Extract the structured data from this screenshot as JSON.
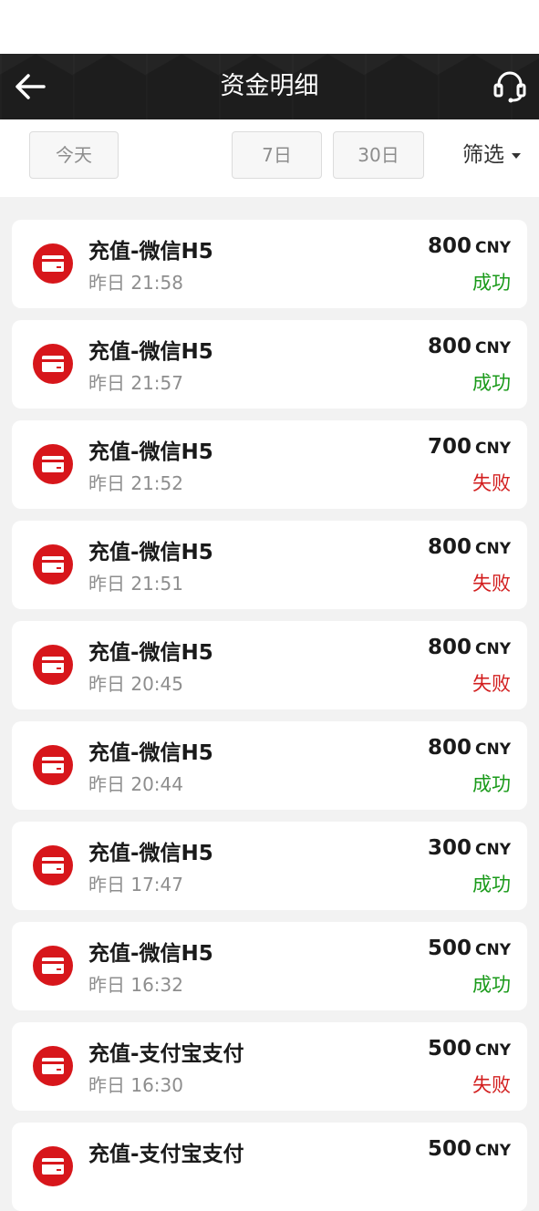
{
  "header": {
    "title": "资金明细"
  },
  "filters": {
    "today": "今天",
    "seven_days": "7日",
    "thirty_days": "30日",
    "filter": "筛选"
  },
  "colors": {
    "success": "#1a9a1a",
    "fail": "#d21e1e",
    "icon": "#d7161b"
  },
  "records": [
    {
      "title": "充值-微信H5",
      "time": "昨日 21:58",
      "amount": "800",
      "currency": "CNY",
      "status": "成功",
      "status_type": "success"
    },
    {
      "title": "充值-微信H5",
      "time": "昨日 21:57",
      "amount": "800",
      "currency": "CNY",
      "status": "成功",
      "status_type": "success"
    },
    {
      "title": "充值-微信H5",
      "time": "昨日 21:52",
      "amount": "700",
      "currency": "CNY",
      "status": "失败",
      "status_type": "fail"
    },
    {
      "title": "充值-微信H5",
      "time": "昨日 21:51",
      "amount": "800",
      "currency": "CNY",
      "status": "失败",
      "status_type": "fail"
    },
    {
      "title": "充值-微信H5",
      "time": "昨日 20:45",
      "amount": "800",
      "currency": "CNY",
      "status": "失败",
      "status_type": "fail"
    },
    {
      "title": "充值-微信H5",
      "time": "昨日 20:44",
      "amount": "800",
      "currency": "CNY",
      "status": "成功",
      "status_type": "success"
    },
    {
      "title": "充值-微信H5",
      "time": "昨日 17:47",
      "amount": "300",
      "currency": "CNY",
      "status": "成功",
      "status_type": "success"
    },
    {
      "title": "充值-微信H5",
      "time": "昨日 16:32",
      "amount": "500",
      "currency": "CNY",
      "status": "成功",
      "status_type": "success"
    },
    {
      "title": "充值-支付宝支付",
      "time": "昨日 16:30",
      "amount": "500",
      "currency": "CNY",
      "status": "失败",
      "status_type": "fail"
    },
    {
      "title": "充值-支付宝支付",
      "time": "",
      "amount": "500",
      "currency": "CNY",
      "status": "",
      "status_type": "fail"
    }
  ]
}
